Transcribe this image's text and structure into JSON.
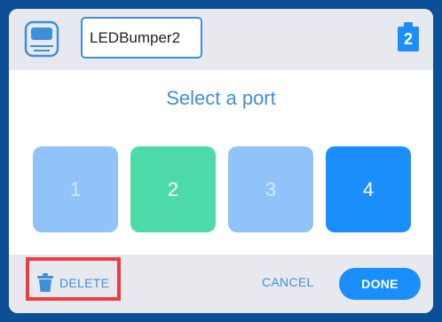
{
  "header": {
    "device_icon": "device-brain-icon",
    "name_value": "LEDBumper2",
    "port_badge": "2"
  },
  "title": "Select a port",
  "ports": [
    {
      "label": "1",
      "state": "unavailable",
      "color": "#8fc3f9"
    },
    {
      "label": "2",
      "state": "in-use",
      "color": "#4cdaa8"
    },
    {
      "label": "3",
      "state": "unavailable",
      "color": "#8fc3f9"
    },
    {
      "label": "4",
      "state": "available",
      "color": "#1a8ffb"
    }
  ],
  "footer": {
    "delete_label": "DELETE",
    "delete_icon": "trash-icon",
    "cancel_label": "CANCEL",
    "done_label": "DONE"
  },
  "colors": {
    "accent": "#3d8fdc",
    "primary": "#1a8ffb",
    "highlight": "#f23b3e",
    "background": "#0b4f97"
  }
}
